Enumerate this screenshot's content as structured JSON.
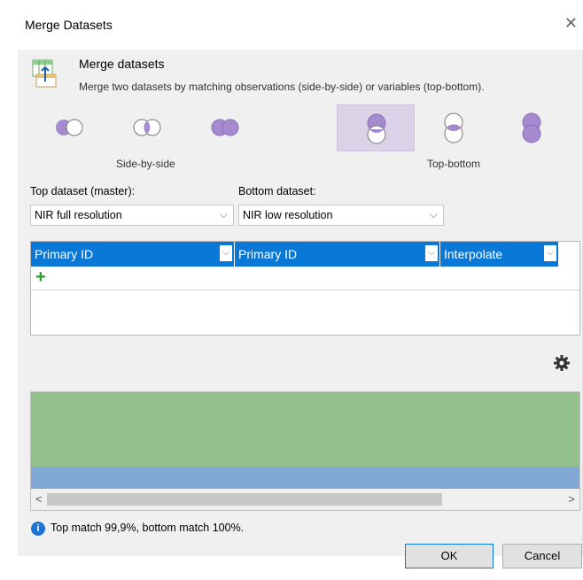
{
  "window": {
    "title": "Merge Datasets"
  },
  "header": {
    "title": "Merge datasets",
    "description": "Merge two datasets by matching observations (side-by-side) or variables (top-bottom)."
  },
  "modes": {
    "side_by_side_label": "Side-by-side",
    "top_bottom_label": "Top-bottom",
    "selected": "top-bottom-left-circle",
    "accent_color": "#9b7fcb"
  },
  "top_dataset": {
    "label": "Top dataset (master):",
    "value": "NIR full resolution"
  },
  "bottom_dataset": {
    "label": "Bottom dataset:",
    "value": "NIR low resolution"
  },
  "match_grid": {
    "columns": [
      "Primary ID",
      "Primary ID",
      "Interpolate"
    ],
    "header_color": "#0a78d7",
    "add_icon": "plus-icon"
  },
  "preview": {
    "top_color": "#93c18e",
    "bottom_color": "#82a8d6"
  },
  "status": {
    "text": "Top match 99,9%, bottom match 100%."
  },
  "buttons": {
    "ok": "OK",
    "cancel": "Cancel"
  }
}
